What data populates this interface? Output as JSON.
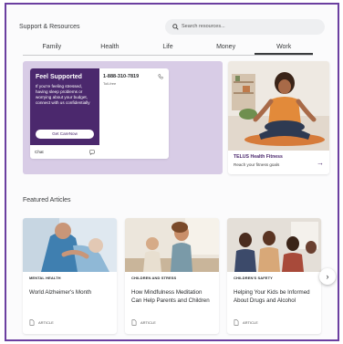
{
  "header": {
    "title": "Support & Resources",
    "search_placeholder": "Search resources..."
  },
  "tabs": [
    {
      "label": "Family"
    },
    {
      "label": "Health"
    },
    {
      "label": "Life"
    },
    {
      "label": "Money"
    },
    {
      "label": "Work",
      "active": true
    }
  ],
  "support_card": {
    "title": "Feel Supported",
    "text": "If you're feeling stressed, having sleep problems or worrying about your budget, connect with us confidentially",
    "button_label": "Get CareNow",
    "phone": "1-888-310-7819",
    "phone_note": "Toll-free",
    "chat_label": "Chat"
  },
  "fitness_card": {
    "title": "TELUS Health Fitness",
    "subtitle": "Reach your fitness goals"
  },
  "featured": {
    "heading": "Featured Articles",
    "articles": [
      {
        "category": "MENTAL HEALTH",
        "title": "World Alzheimer's Month",
        "type": "ARTICLE"
      },
      {
        "category": "CHILDREN AND STRESS",
        "title": "How Mindfulness Meditation Can Help Parents and Children",
        "type": "ARTICLE"
      },
      {
        "category": "CHILDREN'S SAFETY",
        "title": "Helping Your Kids be Informed About Drugs and Alcohol",
        "type": "ARTICLE"
      }
    ]
  },
  "colors": {
    "brand_purple": "#4b286d",
    "hero_background": "#d8cce6",
    "frame_border": "#6b3fa0"
  },
  "icons": [
    "search-icon",
    "phone-icon",
    "chat-icon",
    "arrow-right-icon",
    "document-icon",
    "chevron-right-icon"
  ]
}
